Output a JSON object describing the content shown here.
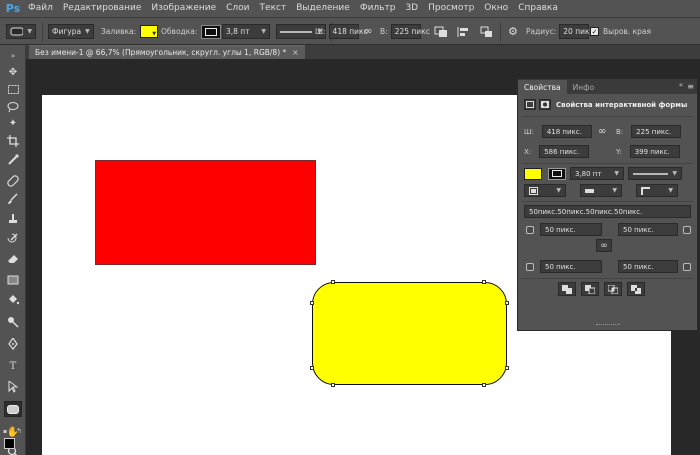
{
  "app": {
    "logo": "Ps"
  },
  "menu": [
    "Файл",
    "Редактирование",
    "Изображение",
    "Слои",
    "Текст",
    "Выделение",
    "Фильтр",
    "3D",
    "Просмотр",
    "Окно",
    "Справка"
  ],
  "options_bar": {
    "mode": "Фигура",
    "fill_label": "Заливка:",
    "fill_color": "#ffff00",
    "stroke_label": "Обводка:",
    "stroke_width": "3,8 пт",
    "width_label": "Ш:",
    "width_value": "418 пикс",
    "height_label": "В:",
    "height_value": "225 пикс",
    "radius_label": "Радиус:",
    "radius_value": "20 пикс",
    "align_edges_label": "Выров. края",
    "align_edges_checked": true
  },
  "document": {
    "tab_title": "Без имени-1 @ 66,7% (Прямоугольник, скругл. углы 1, RGB/8) *",
    "close": "×"
  },
  "shapes": {
    "red_color": "#ff0000",
    "yellow_color": "#ffff00"
  },
  "properties": {
    "tab_properties": "Свойства",
    "tab_info": "Инфо",
    "title": "Свойства интерактивной формы",
    "w_label": "Ш:",
    "w_value": "418 пикс.",
    "h_label": "В:",
    "h_value": "225 пикс.",
    "x_label": "X:",
    "x_value": "586 пикс.",
    "y_label": "Y:",
    "y_value": "399 пикс.",
    "stroke_width": "3,80 пт",
    "corners_summary": "50пикс.50пикс.50пикс.50пикс.",
    "corner_tl": "50 пикс.",
    "corner_tr": "50 пикс.",
    "corner_bl": "50 пикс.",
    "corner_br": "50 пикс."
  },
  "icons": {
    "menu_panel": "≡",
    "collapse": "«",
    "link": "∞",
    "dropdown": "▼",
    "gear": "⚙"
  }
}
